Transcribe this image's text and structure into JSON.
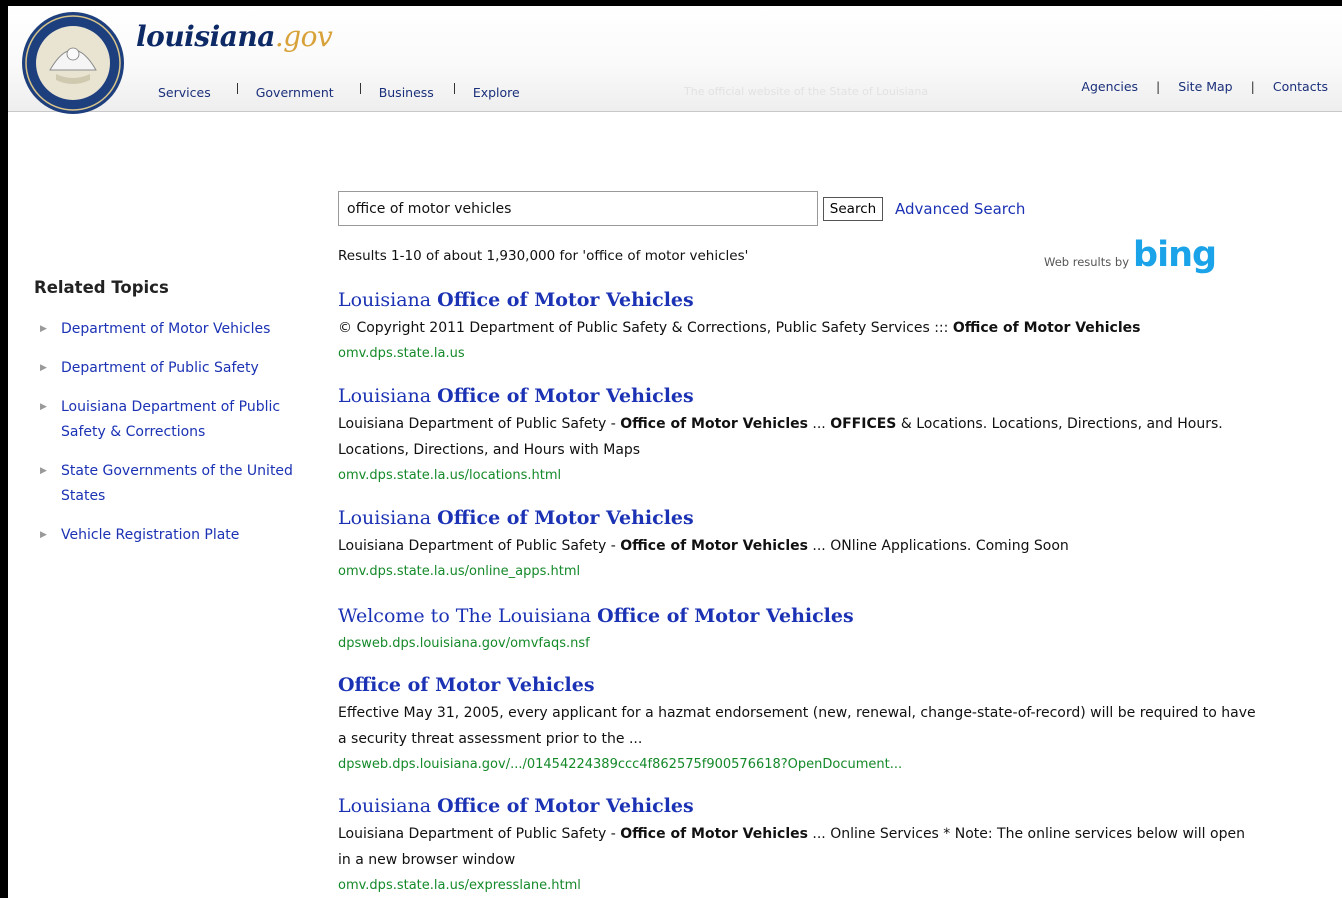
{
  "header": {
    "logo_text": "louisiana",
    "logo_suffix": ".gov",
    "seal_alt": "State of Louisiana seal",
    "nav": [
      "Services",
      "Government",
      "Business",
      "Explore"
    ],
    "tagline": "The official website of the State of Louisiana",
    "util": [
      "Agencies",
      "Site Map",
      "Contacts"
    ]
  },
  "search": {
    "value": "office of motor vehicles",
    "button_label": "Search",
    "advanced_label": "Advanced Search",
    "result_count": "Results 1-10 of about 1,930,000 for 'office of motor vehicles'",
    "attribution_prefix": "Web results by",
    "attribution_brand": "bing"
  },
  "sidebar": {
    "title": "Related Topics",
    "items": [
      "Department of Motor Vehicles",
      "Department of Public Safety",
      "Louisiana Department of Public Safety & Corrections",
      "State Governments of the United States",
      "Vehicle Registration Plate"
    ]
  },
  "results": [
    {
      "title_pre": "Louisiana ",
      "title_bold": "Office of Motor Vehicles",
      "snippet": [
        {
          "t": "© Copyright 2011 Department of Public Safety & Corrections, Public Safety Services ::: ",
          "b": false
        },
        {
          "t": "Office of Motor Vehicles",
          "b": true
        }
      ],
      "url": "omv.dps.state.la.us"
    },
    {
      "title_pre": "Louisiana ",
      "title_bold": "Office of Motor Vehicles",
      "snippet": [
        {
          "t": "Louisiana Department of Public Safety - ",
          "b": false
        },
        {
          "t": "Office of Motor Vehicles",
          "b": true
        },
        {
          "t": " ... ",
          "b": false
        },
        {
          "t": "OFFICES",
          "b": true
        },
        {
          "t": " & Locations. Locations, Directions, and Hours. Locations, Directions, and Hours with Maps",
          "b": false
        }
      ],
      "url": "omv.dps.state.la.us/locations.html"
    },
    {
      "title_pre": "Louisiana ",
      "title_bold": "Office of Motor Vehicles",
      "snippet": [
        {
          "t": "Louisiana Department of Public Safety - ",
          "b": false
        },
        {
          "t": "Office of Motor Vehicles",
          "b": true
        },
        {
          "t": " ... ONline Applications. Coming Soon",
          "b": false
        }
      ],
      "url": "omv.dps.state.la.us/online_apps.html"
    },
    {
      "title_pre": "Welcome to The Louisiana ",
      "title_bold": "Office of Motor Vehicles",
      "snippet": [],
      "url": "dpsweb.dps.louisiana.gov/omvfaqs.nsf"
    },
    {
      "title_pre": "",
      "title_bold": "Office of Motor Vehicles",
      "snippet": [
        {
          "t": "Effective May 31, 2005, every applicant for a hazmat endorsement (new, renewal, change-state-of-record) will be required to have a security threat assessment prior to the ...",
          "b": false
        }
      ],
      "url": "dpsweb.dps.louisiana.gov/.../01454224389ccc4f862575f900576618?OpenDocument..."
    },
    {
      "title_pre": "Louisiana ",
      "title_bold": "Office of Motor Vehicles",
      "snippet": [
        {
          "t": "Louisiana Department of Public Safety - ",
          "b": false
        },
        {
          "t": "Office of Motor Vehicles",
          "b": true
        },
        {
          "t": " ... Online Services * Note: The online services below will open in a new browser window",
          "b": false
        }
      ],
      "url": "omv.dps.state.la.us/expresslane.html"
    }
  ],
  "colors": {
    "link": "#1b32b4",
    "url_green": "#158a2a",
    "bing_blue": "#1aa3e8",
    "logo_navy": "#0d2a66",
    "logo_gold": "#d8a23a"
  }
}
